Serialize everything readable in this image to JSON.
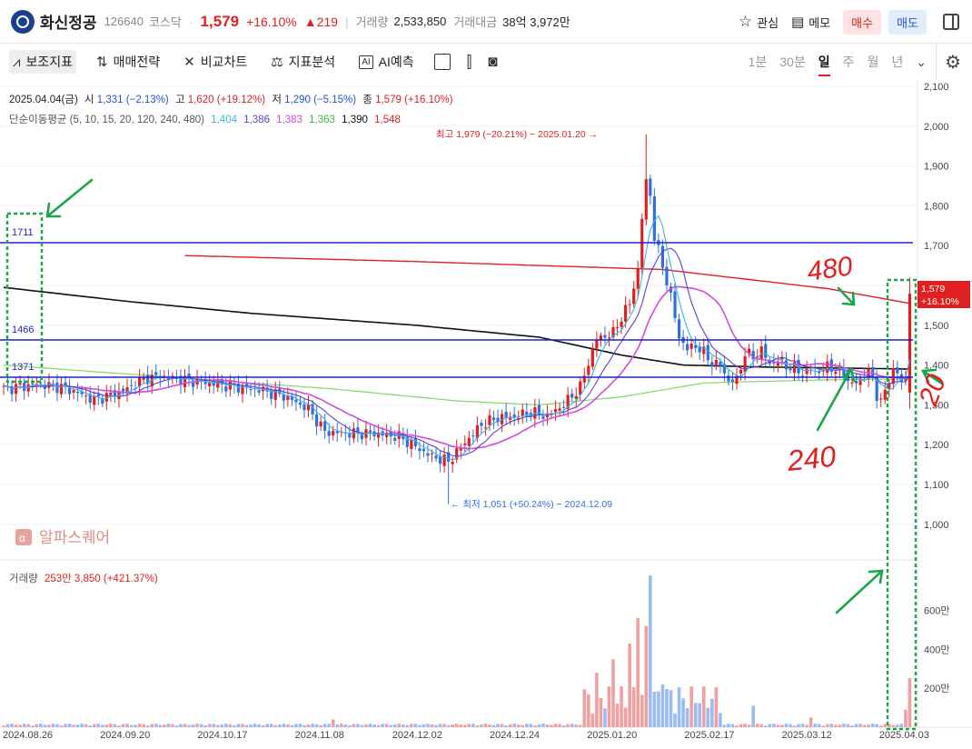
{
  "header": {
    "stock_name": "화신정공",
    "code": "126640",
    "market": "코스닥",
    "price": "1,579",
    "change_pct": "+16.10%",
    "change_abs": "▲219",
    "volume_label": "거래량",
    "volume": "2,533,850",
    "amount_label": "거래대금",
    "amount": "38억 3,972만",
    "watch_label": "관심",
    "memo_label": "메모",
    "buy_label": "매수",
    "sell_label": "매도"
  },
  "toolbar": {
    "indicators_label": "보조지표",
    "strategy_label": "매매전략",
    "compare_label": "비교차트",
    "analysis_label": "지표분석",
    "ai_label": "AI예측",
    "periods": [
      "1분",
      "30분",
      "일",
      "주",
      "월",
      "년"
    ],
    "selected_period": "일"
  },
  "ohlc_info": {
    "date": "2025.04.04(금)",
    "open_label": "시",
    "open": "1,331 (−2.13%)",
    "high_label": "고",
    "high": "1,620 (+19.12%)",
    "low_label": "저",
    "low": "1,290 (−5.15%)",
    "close_label": "종",
    "close": "1,579 (+16.10%)"
  },
  "ma_info": {
    "label": "단순이동평균 (5, 10, 15, 20, 120, 240, 480)",
    "values": [
      {
        "value": "1,404",
        "color": "#38b6e6"
      },
      {
        "value": "1,386",
        "color": "#5a3fd6"
      },
      {
        "value": "1,383",
        "color": "#d24dd6"
      },
      {
        "value": "1,363",
        "color": "#36b83a"
      },
      {
        "value": "1,390",
        "color": "#111111"
      },
      {
        "value": "1,548",
        "color": "#e02020"
      }
    ]
  },
  "annotations": {
    "high_note": "최고 1,979 (−20.21%) − 2025.01.20 →",
    "low_note": "← 최저 1,051 (+50.24%) − 2024.12.09",
    "hline_1711": "1711",
    "hline_1466": "1466",
    "hline_1371": "1371",
    "price_tag_1": "1,579",
    "price_tag_2": "+16.10%",
    "handwritten_480": "480",
    "handwritten_240": "240",
    "handwritten_20": "20",
    "watermark": "알파스퀘어"
  },
  "volume_info": {
    "label": "거래량",
    "value": "253만 3,850 (+421.37%)"
  },
  "axes": {
    "price_ticks": [
      "2,100",
      "2,000",
      "1,900",
      "1,800",
      "1,700",
      "1,600",
      "1,500",
      "1,400",
      "1,300",
      "1,200",
      "1,100",
      "1,000"
    ],
    "volume_ticks": [
      "600만",
      "400만",
      "200만"
    ],
    "date_ticks": [
      "2024.08.26",
      "2024.09.20",
      "2024.10.17",
      "2024.11.08",
      "2024.12.02",
      "2024.12.24",
      "2025.01.20",
      "2025.02.17",
      "2025.03.12",
      "2025.04.03"
    ]
  },
  "colors": {
    "up": "#e02020",
    "down": "#2f6fe0",
    "hline": "#2020d0",
    "ma480": "#e02020",
    "ma240": "#111111",
    "ma120": "#7fd96a",
    "ma20": "#d24dd6",
    "ma10": "#5a3fd6",
    "ma5": "#38b6e6",
    "marker": "#1aa54a"
  }
}
